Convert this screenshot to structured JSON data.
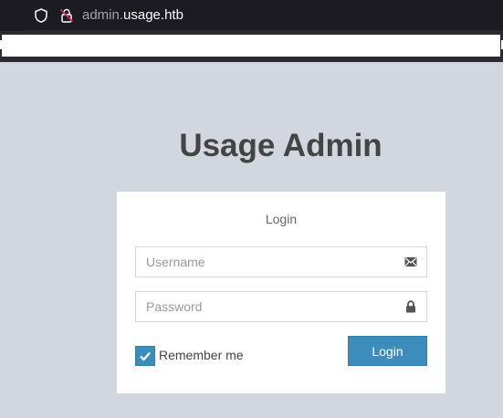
{
  "browser": {
    "url_prefix": "admin.",
    "url_domain": "usage.htb"
  },
  "page": {
    "title": "Usage Admin"
  },
  "login_box": {
    "heading": "Login",
    "username_placeholder": "Username",
    "password_placeholder": "Password",
    "remember_label": "Remember me",
    "remember_checked": true,
    "submit_label": "Login"
  },
  "colors": {
    "page_background": "#d2d6de",
    "primary_button": "#3c8dbc",
    "browser_chrome": "#2b2a33"
  },
  "icons": {
    "address_security": "shield-icon",
    "address_lock": "lock-slash-icon",
    "username_field": "envelope-icon",
    "password_field": "lock-icon",
    "checkbox": "checkmark-icon"
  }
}
